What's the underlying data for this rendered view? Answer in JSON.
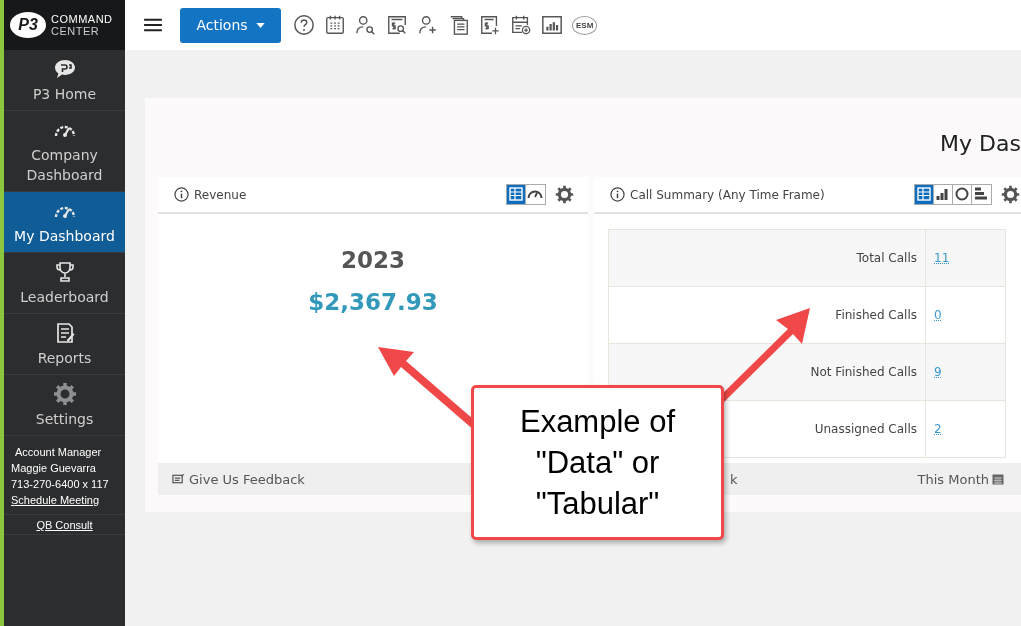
{
  "logo": {
    "mark": "P3",
    "line1": "COMMAND",
    "line2": "CENTER"
  },
  "sidebar": {
    "items": [
      {
        "label": "P3 Home",
        "kind": "bubble",
        "selected": false
      },
      {
        "label": "Company Dashboard",
        "kind": "gauge",
        "selected": false
      },
      {
        "label": "My Dashboard",
        "kind": "gauge",
        "selected": true
      },
      {
        "label": "Leaderboard",
        "kind": "trophy",
        "selected": false
      },
      {
        "label": "Reports",
        "kind": "report",
        "selected": false
      },
      {
        "label": "Settings",
        "kind": "gear",
        "selected": false
      }
    ],
    "account": {
      "title": "Account Manager",
      "name": "Maggie Guevarra",
      "phone": "713-270-6400 x 117",
      "link": "Schedule Meeting"
    },
    "consult": "QB Consult"
  },
  "toolbar": {
    "actions": "Actions",
    "icons": [
      {
        "kind": "help"
      },
      {
        "kind": "calendar"
      },
      {
        "kind": "user-search"
      },
      {
        "kind": "money-search"
      },
      {
        "kind": "user-add"
      },
      {
        "kind": "documents"
      },
      {
        "kind": "money-add"
      },
      {
        "kind": "calendar-add"
      },
      {
        "kind": "chart"
      },
      {
        "kind": "badge",
        "label": "ESM"
      }
    ]
  },
  "dashboard_title": "My Das",
  "revenue_card": {
    "title": "Revenue",
    "views": [
      {
        "kind": "table",
        "selected": true
      },
      {
        "kind": "gauge",
        "selected": false
      }
    ],
    "year": "2023",
    "amount": "$2,367.93",
    "footer": "Give Us Feedback"
  },
  "call_card": {
    "title": "Call Summary (Any Time Frame)",
    "views": [
      {
        "kind": "table",
        "selected": true
      },
      {
        "kind": "bar",
        "selected": false
      },
      {
        "kind": "donut",
        "selected": false
      },
      {
        "kind": "hbar",
        "selected": false
      }
    ],
    "rows": [
      {
        "label": "Total Calls",
        "value": "11"
      },
      {
        "label": "Finished Calls",
        "value": "0"
      },
      {
        "label": "Not Finished Calls",
        "value": "9"
      },
      {
        "label": "Unassigned Calls",
        "value": "2"
      }
    ],
    "footer_left": "k",
    "footer_right": "This Month"
  },
  "callout": {
    "lines": [
      "Example of",
      "\"Data\" or",
      "\"Tabular\""
    ]
  }
}
